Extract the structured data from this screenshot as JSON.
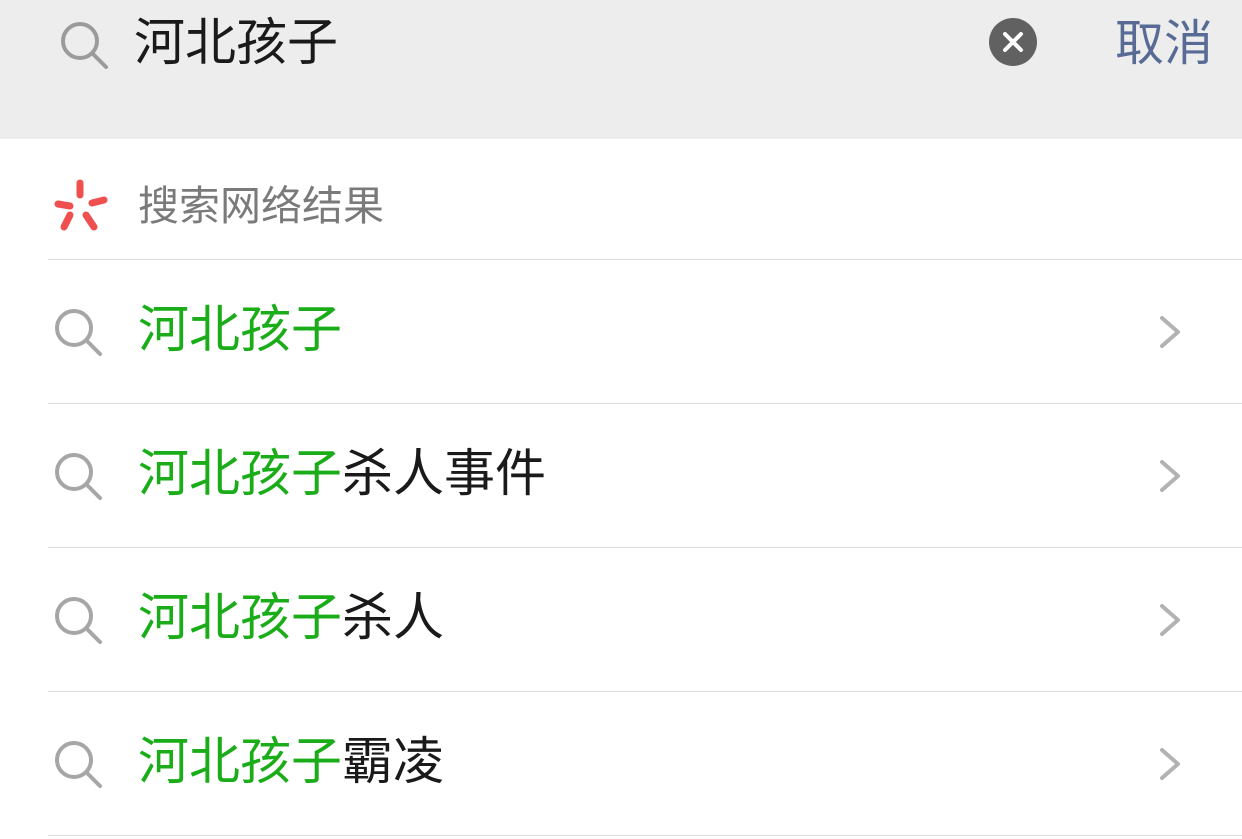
{
  "search": {
    "query": "河北孩子",
    "cancel_label": "取消"
  },
  "web_search": {
    "label": "搜索网络结果"
  },
  "suggestions": [
    {
      "highlight": "河北孩子",
      "rest": ""
    },
    {
      "highlight": "河北孩子",
      "rest": "杀人事件"
    },
    {
      "highlight": "河北孩子",
      "rest": "杀人"
    },
    {
      "highlight": "河北孩子",
      "rest": "霸凌"
    }
  ],
  "colors": {
    "header_bg": "#ededed",
    "highlight": "#1aad19",
    "cancel": "#576b95",
    "logo": "#f04f4f"
  },
  "icons": {
    "search": "search-icon",
    "clear": "clear-icon",
    "logo": "search-network-icon",
    "chevron": "chevron-right-icon"
  }
}
